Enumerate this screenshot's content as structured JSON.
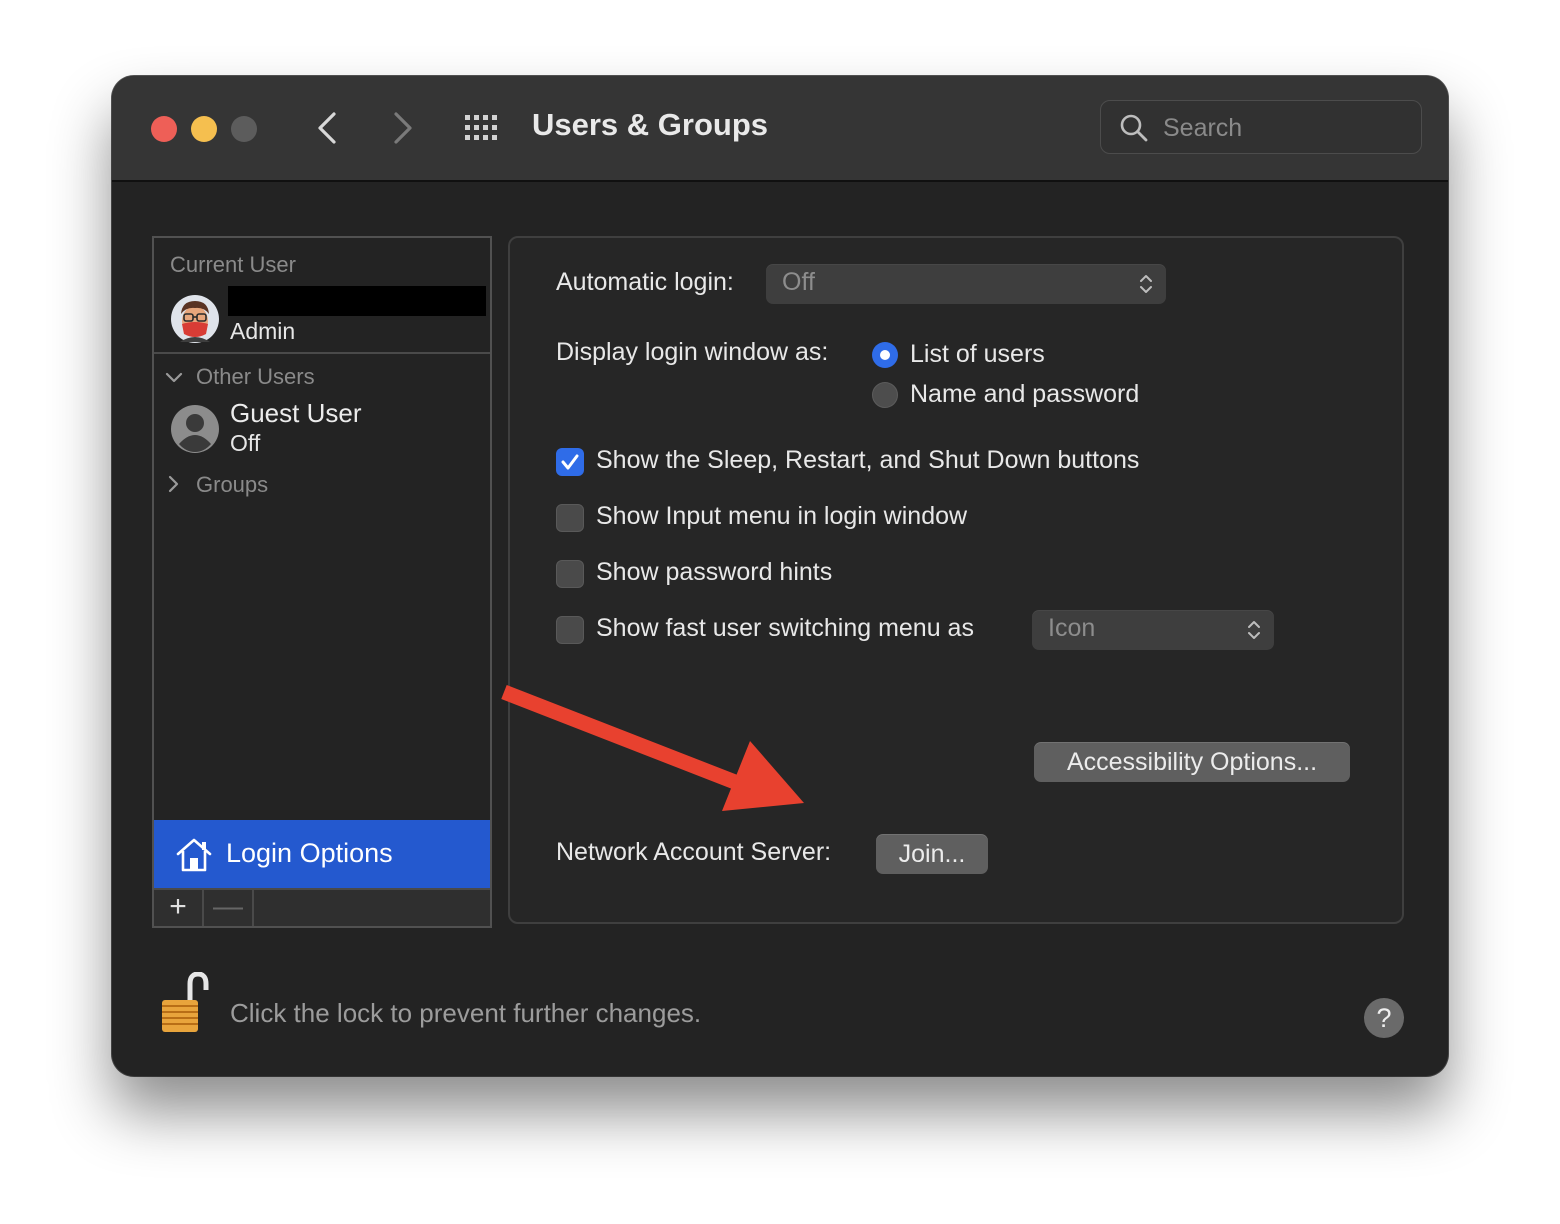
{
  "window": {
    "title": "Users & Groups",
    "search_placeholder": "Search"
  },
  "sidebar": {
    "current_user_heading": "Current User",
    "current_user_role": "Admin",
    "other_users_heading": "Other Users",
    "guest_name": "Guest User",
    "guest_status": "Off",
    "groups_heading": "Groups",
    "selected_item_label": "Login Options",
    "add_label": "+",
    "remove_label": "—"
  },
  "login_options": {
    "automatic_login_label": "Automatic login:",
    "automatic_login_value": "Off",
    "display_as_label": "Display login window as:",
    "display_options": [
      "List of users",
      "Name and password"
    ],
    "display_selected": "List of users",
    "checkboxes": [
      {
        "label": "Show the Sleep, Restart, and Shut Down buttons",
        "checked": true
      },
      {
        "label": "Show Input menu in login window",
        "checked": false
      },
      {
        "label": "Show password hints",
        "checked": false
      },
      {
        "label": "Show fast user switching menu as",
        "checked": false
      }
    ],
    "fast_switch_value": "Icon",
    "accessibility_button": "Accessibility Options...",
    "network_server_label": "Network Account Server:",
    "join_button": "Join..."
  },
  "footer": {
    "lock_text": "Click the lock to prevent further changes.",
    "help_label": "?"
  },
  "colors": {
    "accent": "#2f6ce8",
    "selection": "#2459cf",
    "annotation_arrow": "#e8412f"
  }
}
